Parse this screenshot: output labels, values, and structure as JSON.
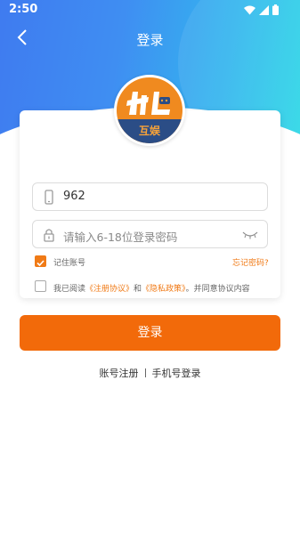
{
  "status_bar": {
    "time": "2:50"
  },
  "nav": {
    "title": "登录"
  },
  "logo": {
    "name": "互娱"
  },
  "form": {
    "phone": {
      "value": "962"
    },
    "password": {
      "placeholder": "请输入6-18位登录密码"
    },
    "remember": {
      "label": "记住账号",
      "checked": true
    },
    "forgot_label": "忘记密码?",
    "agreement": {
      "checked": false,
      "prefix": "我已阅读",
      "terms": "《注册协议》",
      "and": "和",
      "privacy": "《隐私政策》",
      "suffix": "。并同意协议内容"
    }
  },
  "login_button": "登录",
  "links": {
    "register": "账号注册",
    "phone_login": "手机号登录"
  },
  "colors": {
    "accent": "#f26a0a",
    "gradient_start": "#3f7bf0",
    "gradient_end": "#2bdbe6",
    "logo_dark": "#2b4d86"
  }
}
